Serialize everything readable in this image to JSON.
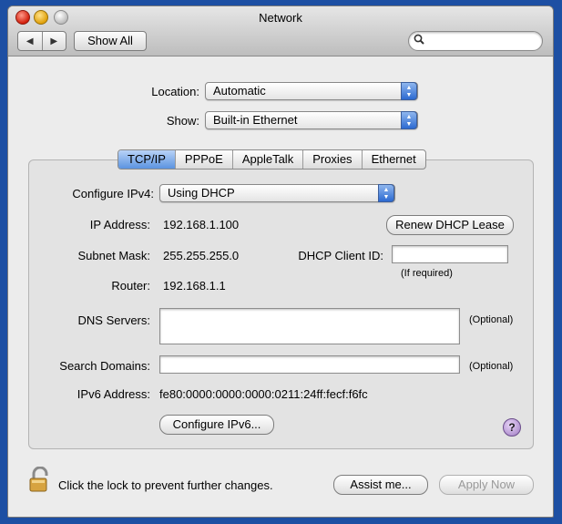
{
  "window": {
    "title": "Network"
  },
  "toolbar": {
    "back_glyph": "◀",
    "forward_glyph": "▶",
    "show_all_label": "Show All",
    "search_icon": "search-icon",
    "search_value": ""
  },
  "location": {
    "label": "Location:",
    "value": "Automatic"
  },
  "show": {
    "label": "Show:",
    "value": "Built-in Ethernet"
  },
  "tabs": [
    {
      "label": "TCP/IP",
      "active": true
    },
    {
      "label": "PPPoE",
      "active": false
    },
    {
      "label": "AppleTalk",
      "active": false
    },
    {
      "label": "Proxies",
      "active": false
    },
    {
      "label": "Ethernet",
      "active": false
    }
  ],
  "tcpip": {
    "configure_label": "Configure IPv4:",
    "configure_value": "Using DHCP",
    "ip_label": "IP Address:",
    "ip_value": "192.168.1.100",
    "renew_label": "Renew DHCP Lease",
    "subnet_label": "Subnet Mask:",
    "subnet_value": "255.255.255.0",
    "dhcp_client_label": "DHCP Client ID:",
    "dhcp_client_value": "",
    "if_required": "(If required)",
    "router_label": "Router:",
    "router_value": "192.168.1.1",
    "dns_label": "DNS Servers:",
    "dns_value": "",
    "dns_optional": "(Optional)",
    "search_label": "Search Domains:",
    "search_value": "",
    "search_optional": "(Optional)",
    "ipv6_label": "IPv6 Address:",
    "ipv6_value": "fe80:0000:0000:0000:0211:24ff:fecf:f6fc",
    "configure_ipv6_label": "Configure IPv6...",
    "help_glyph": "?"
  },
  "footer": {
    "lock_text": "Click the lock to prevent further changes.",
    "assist_label": "Assist me...",
    "apply_label": "Apply Now"
  },
  "colors": {
    "desktop": "#1d4fa3",
    "accent_blue": "#5b93e0",
    "help_purple": "#9e7ac2",
    "lock_gold": "#d7a340"
  }
}
